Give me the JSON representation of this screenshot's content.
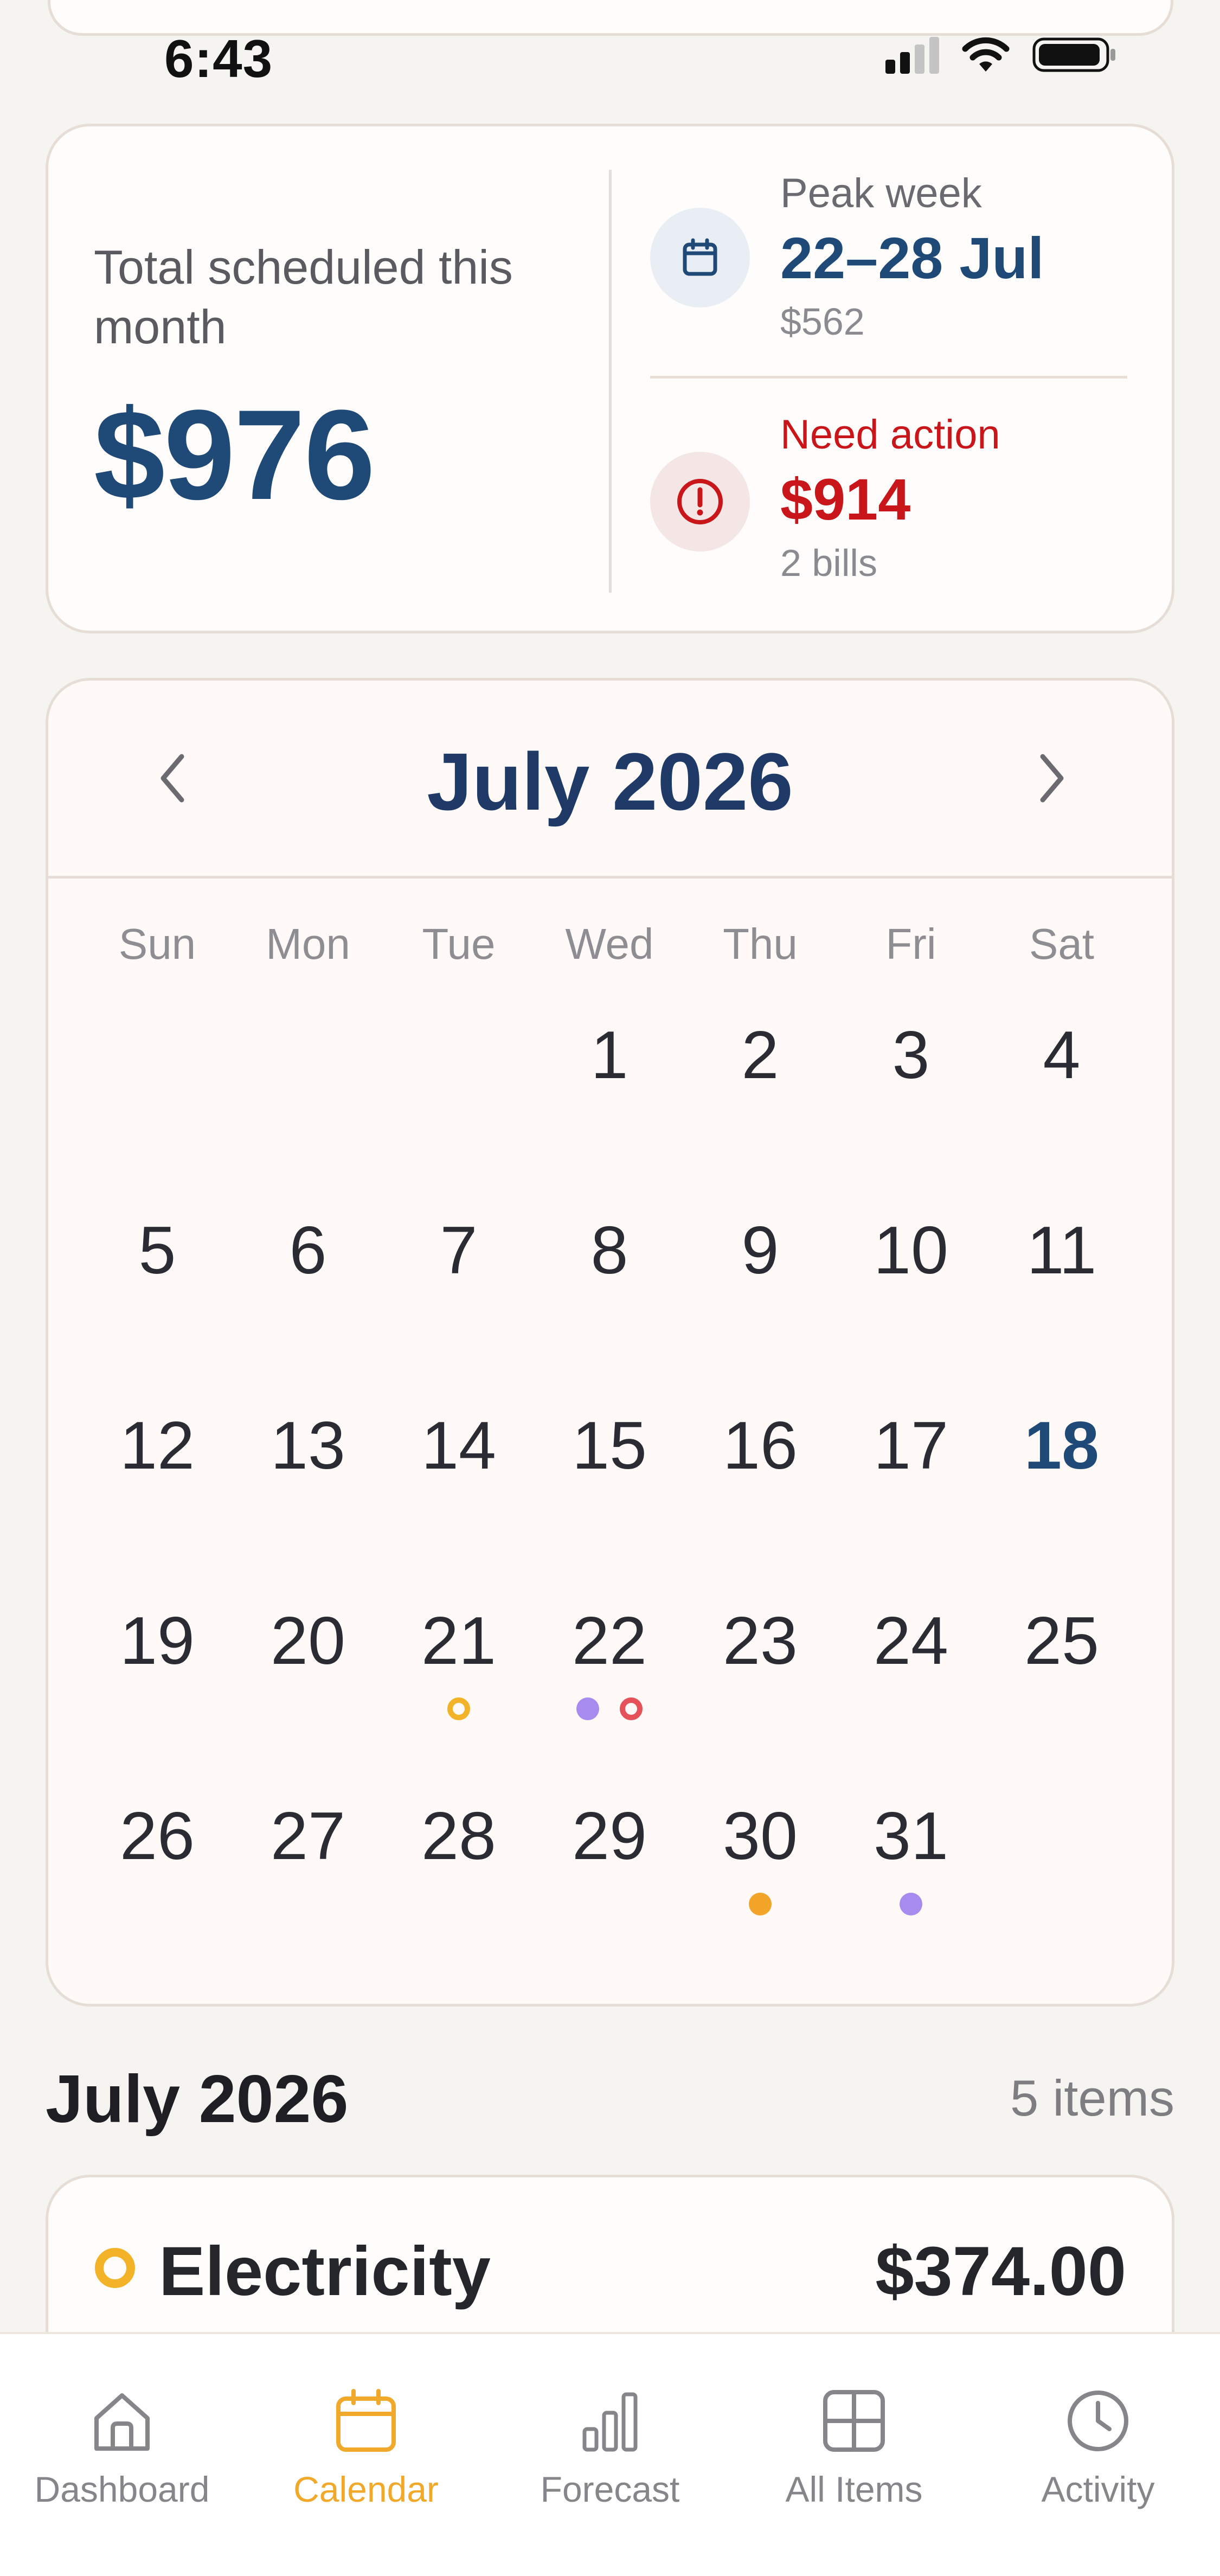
{
  "status_bar": {
    "time": "6:43"
  },
  "summary": {
    "label": "Total scheduled this month",
    "amount": "$976",
    "peak_week": {
      "title": "Peak week",
      "range": "22–28 Jul",
      "amount": "$562",
      "icon": "calendar-icon",
      "color": "#1f4a78"
    },
    "need_action": {
      "title": "Need action",
      "amount": "$914",
      "count": "2 bills",
      "icon": "alert-circle-icon",
      "color": "#c8161a"
    }
  },
  "calendar": {
    "month_label": "July 2026",
    "weekdays": [
      "Sun",
      "Mon",
      "Tue",
      "Wed",
      "Thu",
      "Fri",
      "Sat"
    ],
    "today": 18,
    "first_weekday_index": 3,
    "days_in_month": 31,
    "markers": {
      "21": [
        {
          "style": "ring",
          "color": "#f3b328"
        }
      ],
      "22": [
        {
          "style": "dot",
          "color": "#a78bef"
        },
        {
          "style": "ring",
          "color": "#e5525a"
        }
      ],
      "30": [
        {
          "style": "dot",
          "color": "#f3a52a"
        }
      ],
      "31": [
        {
          "style": "dot",
          "color": "#a78bef"
        }
      ]
    }
  },
  "list": {
    "title": "July 2026",
    "count": "5 items",
    "items": [
      {
        "name": "Electricity",
        "amount": "$374.00",
        "marker_color": "#f3b328"
      }
    ]
  },
  "tabs": [
    {
      "label": "Dashboard",
      "icon": "home-icon",
      "active": false
    },
    {
      "label": "Calendar",
      "icon": "calendar-icon",
      "active": true
    },
    {
      "label": "Forecast",
      "icon": "bar-chart-icon",
      "active": false
    },
    {
      "label": "All Items",
      "icon": "grid-icon",
      "active": false
    },
    {
      "label": "Activity",
      "icon": "clock-icon",
      "active": false
    }
  ],
  "colors": {
    "accent": "#f0a92a",
    "primary": "#1f4a78",
    "danger": "#c8161a"
  }
}
